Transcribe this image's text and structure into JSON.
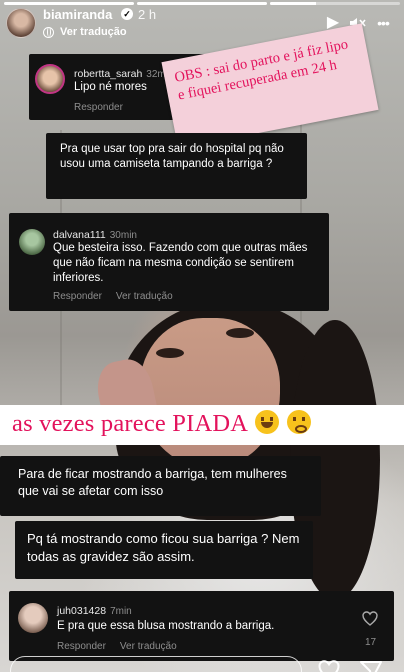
{
  "header": {
    "username": "biamiranda",
    "time": "2 h",
    "translate_label": "Ver tradução"
  },
  "note": {
    "text": "OBS : sai do parto e já fiz lipo e fiquei recuperada em 24 h"
  },
  "comments": {
    "c1": {
      "user": "robertta_sarah",
      "time": "32min",
      "text": "Lipo né mores",
      "reply": "Responder"
    },
    "c2": {
      "text": "Pra que usar top pra sair do hospital pq não usou uma camiseta tampando a barriga ?"
    },
    "c3": {
      "user": "dalvana111",
      "time": "30min",
      "text": "Que besteira isso. Fazendo com que outras mães que não ficam na mesma condição se sentirem inferiores.",
      "reply": "Responder",
      "translate": "Ver tradução"
    },
    "c4": {
      "text": "Para de ficar mostrando a barriga, tem mulheres que vai se afetar com isso"
    },
    "c5": {
      "text": "Pq tá mostrando como ficou sua barriga ? Nem todas as gravidez são assim."
    },
    "c6": {
      "user": "juh031428",
      "time": "7min",
      "text": "E pra que essa blusa mostrando a barriga.",
      "reply": "Responder",
      "translate": "Ver tradução",
      "likes": "17"
    }
  },
  "banner": {
    "text": "as vezes parece PIADA"
  },
  "icons": [
    "verified-icon",
    "globe-icon",
    "play-icon",
    "mute-icon",
    "more-icon",
    "heart-icon",
    "share-icon",
    "laughing-emoji",
    "neutral-emoji"
  ]
}
